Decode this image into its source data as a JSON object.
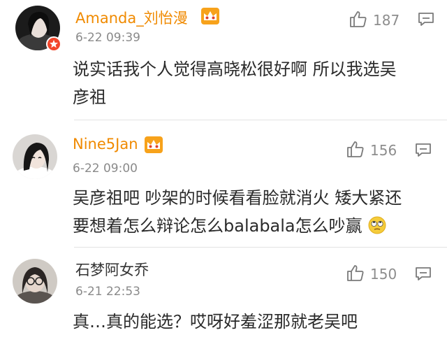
{
  "comments": [
    {
      "username": "Amanda_刘怡漫",
      "time": "6-22 09:39",
      "likes": "187",
      "text_lines": [
        "说实话我个人觉得高晓松很好啊  所以我选吴",
        "彦祖"
      ],
      "vip": true,
      "verified": true
    },
    {
      "username": "Nine5Jan",
      "time": "6-22 09:00",
      "likes": "156",
      "text_lines": [
        "吴彦祖吧 吵架的时候看看脸就消火 矮大紧还",
        "要想着怎么辩论怎么balabala怎么吵赢"
      ],
      "vip": true,
      "verified": false,
      "emoji": "rolling-eyes-emoji"
    },
    {
      "username": "石梦阿女乔",
      "time": "6-21 22:53",
      "likes": "150",
      "text_lines": [
        "真…真的能选？哎呀好羞涩那就老吴吧"
      ],
      "vip": false,
      "verified": false
    }
  ],
  "colors": {
    "vip_name": "#f08a00",
    "verified_badge": "#f2462b",
    "meta": "#8a8a8a",
    "divider": "#e3e3e3"
  },
  "icons": [
    "thumbs-up-icon",
    "comment-reply-icon",
    "vip-crown-icon"
  ]
}
